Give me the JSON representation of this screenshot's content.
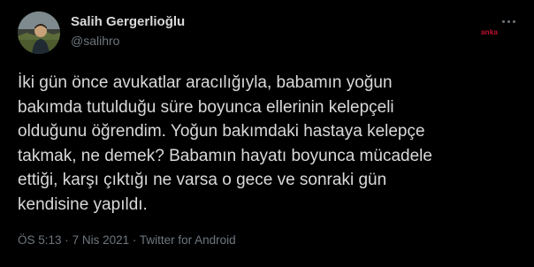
{
  "tweet": {
    "display_name": "Salih Gergerlioğlu",
    "handle": "@salihro",
    "text": "İki gün önce avukatlar aracılığıyla, babamın yoğun\nbakımda tutulduğu süre boyunca ellerinin kelepçeli\nolduğunu öğrendim. Yoğun bakımdaki hastaya kelepçe\ntakmak, ne demek? Babamın hayatı boyunca mücadele\nettiği, karşı çıktığı ne varsa o gece ve sonraki gün\nkendisine yapıldı.",
    "time": "ÖS 5:13",
    "separator": "·",
    "date": "7 Nis 2021",
    "source": "Twitter for Android"
  },
  "watermark": {
    "text": "anka",
    "color": "#c8102e"
  },
  "icons": {
    "more": "more-horizontal-icon",
    "avatar": "user-avatar"
  },
  "colors": {
    "background": "#000000",
    "text": "#d9d9d9",
    "secondary": "#6e767d"
  }
}
